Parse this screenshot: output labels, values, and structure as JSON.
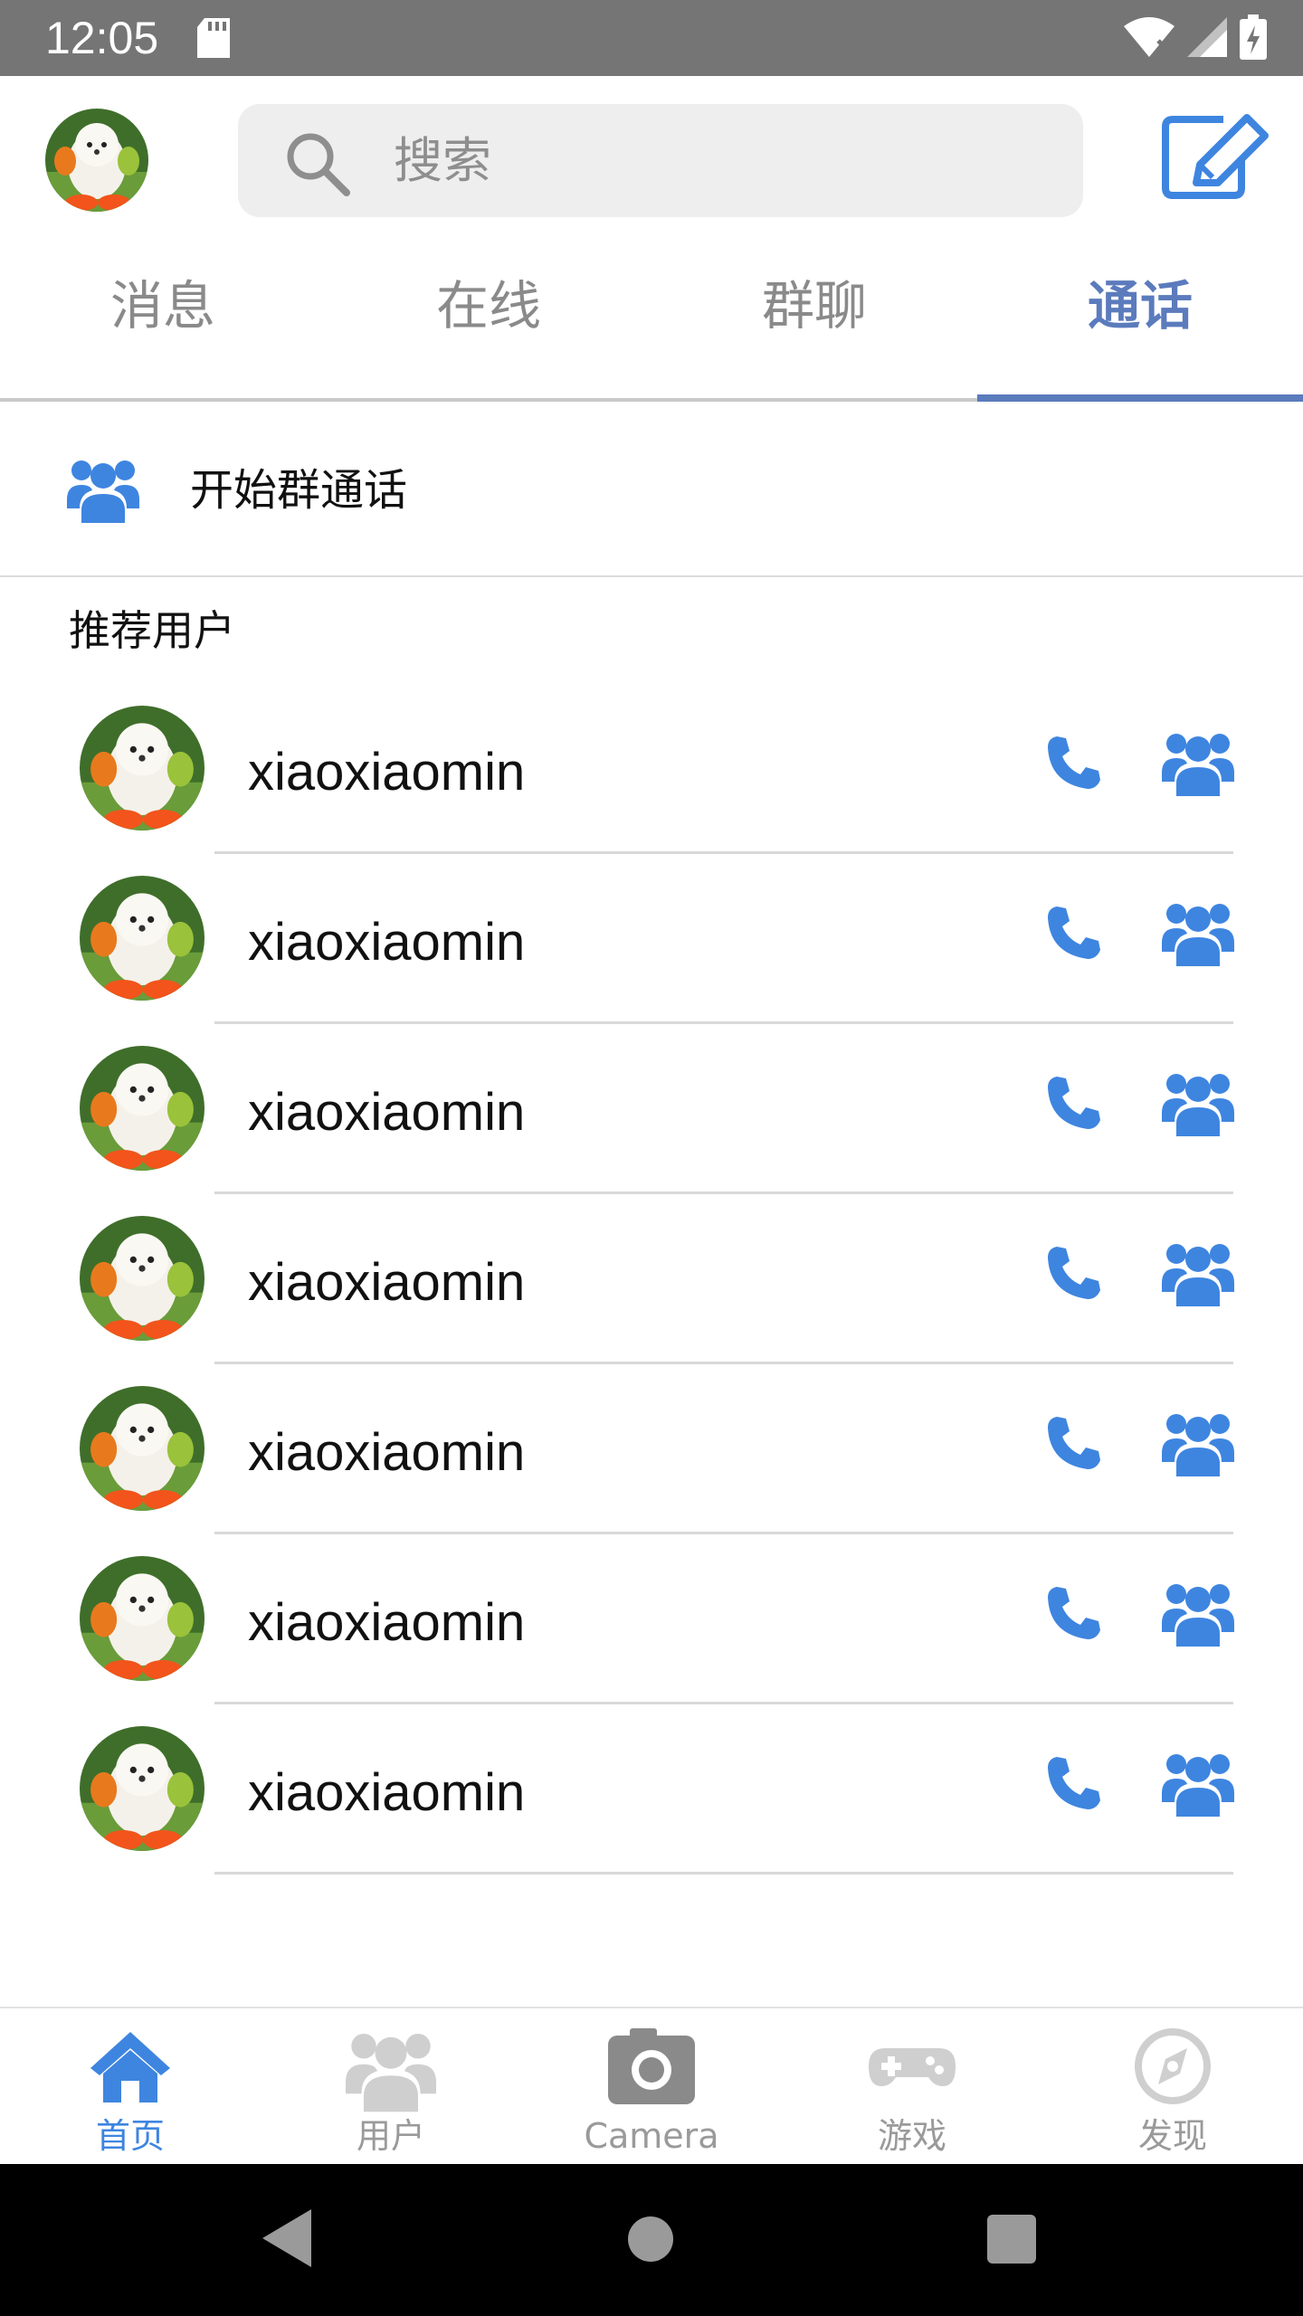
{
  "status_bar": {
    "time": "12:05",
    "icons": [
      "sd-card-icon",
      "wifi-icon",
      "signal-icon",
      "battery-charging-icon"
    ]
  },
  "header": {
    "avatar_icon": "user-avatar-poodle",
    "search_placeholder": "搜索",
    "search_icon": "search-icon",
    "compose_icon": "edit-icon"
  },
  "tabs": [
    {
      "label": "消息",
      "active": false
    },
    {
      "label": "在线",
      "active": false
    },
    {
      "label": "群聊",
      "active": false
    },
    {
      "label": "通话",
      "active": true
    }
  ],
  "group_call": {
    "icon": "group-icon",
    "label": "开始群通话"
  },
  "section_title": "推荐用户",
  "users": [
    {
      "name": "xiaoxiaomin"
    },
    {
      "name": "xiaoxiaomin"
    },
    {
      "name": "xiaoxiaomin"
    },
    {
      "name": "xiaoxiaomin"
    },
    {
      "name": "xiaoxiaomin"
    },
    {
      "name": "xiaoxiaomin"
    },
    {
      "name": "xiaoxiaomin"
    }
  ],
  "bottom_nav": [
    {
      "label": "首页",
      "icon": "home-icon",
      "active": true
    },
    {
      "label": "用户",
      "icon": "users-icon",
      "active": false
    },
    {
      "label": "Camera",
      "icon": "camera-icon",
      "active": false
    },
    {
      "label": "游戏",
      "icon": "gamepad-icon",
      "active": false
    },
    {
      "label": "发现",
      "icon": "compass-icon",
      "active": false
    }
  ],
  "colors": {
    "accent": "#3e85e0",
    "tab_active": "#5b7bbd",
    "status_bar": "#757575",
    "inactive": "#9a9a9a"
  }
}
